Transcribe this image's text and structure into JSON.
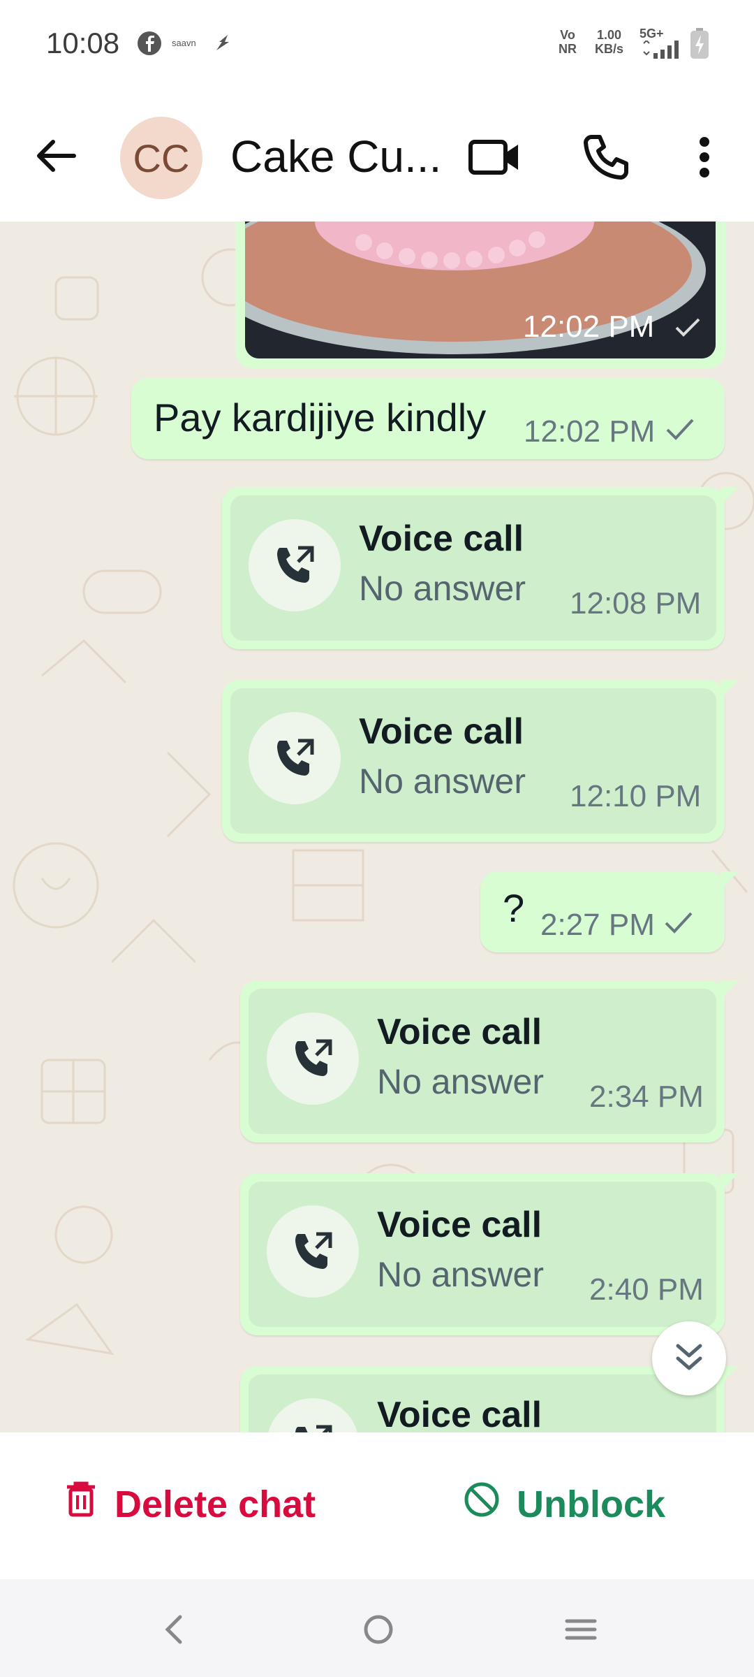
{
  "status_bar": {
    "time": "10:08",
    "notification_icons": [
      "facebook-icon",
      "saavn-icon",
      "wind-icon"
    ],
    "saavn_text": "saavn",
    "volte": [
      "Vo",
      "NR"
    ],
    "speed": [
      "1.00",
      "KB/s"
    ],
    "network": "5G+",
    "battery": "charging"
  },
  "header": {
    "avatar_initials": "CC",
    "contact_name": "Cake Cu...",
    "icons": [
      "back-arrow-icon",
      "video-call-icon",
      "phone-icon",
      "more-options-icon"
    ]
  },
  "messages": [
    {
      "type": "image",
      "time": "12:02 PM",
      "status": "sent"
    },
    {
      "type": "text",
      "text": "Pay kardijiye kindly",
      "time": "12:02 PM",
      "status": "sent"
    },
    {
      "type": "call",
      "title": "Voice call",
      "subtitle": "No answer",
      "time": "12:08 PM"
    },
    {
      "type": "call",
      "title": "Voice call",
      "subtitle": "No answer",
      "time": "12:10 PM"
    },
    {
      "type": "text",
      "text": "?",
      "time": "2:27 PM",
      "status": "sent"
    },
    {
      "type": "call",
      "title": "Voice call",
      "subtitle": "No answer",
      "time": "2:34 PM"
    },
    {
      "type": "call",
      "title": "Voice call",
      "subtitle": "No answer",
      "time": "2:40 PM"
    },
    {
      "type": "call",
      "title": "Voice call"
    }
  ],
  "actions": {
    "delete_label": "Delete chat",
    "unblock_label": "Unblock"
  },
  "colors": {
    "delete": "#d70b3e",
    "unblock": "#1b8b5b",
    "bubble": "#d9fdd3",
    "chat_bg": "#efeae2"
  }
}
